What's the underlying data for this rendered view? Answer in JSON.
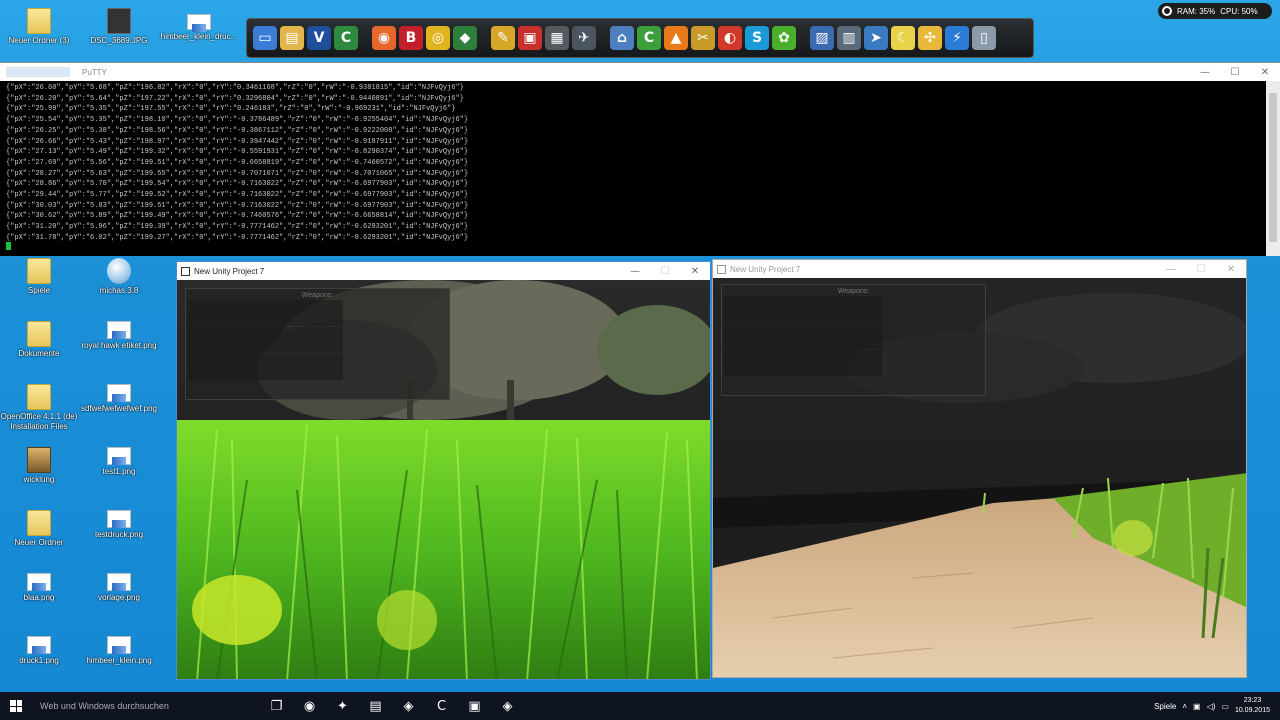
{
  "desktop_icons_top": [
    {
      "label": "Neuer Ordner (3)",
      "icon": "folder-icon"
    },
    {
      "label": "DSC_3689.JPG",
      "icon": "image-file-icon"
    },
    {
      "label": "himbeer_klein_druc...",
      "icon": "png-file-icon"
    }
  ],
  "desktop_icons": [
    {
      "label": "Spiele",
      "icon": "folder-icon"
    },
    {
      "label": "michas.3.8",
      "icon": "globe-icon"
    },
    {
      "label": "Dokumente",
      "icon": "folder-icon"
    },
    {
      "label": "royal hawk etiket.png",
      "icon": "png-file-icon"
    },
    {
      "label": "OpenOffice 4.1.1 (de) Installation Files",
      "icon": "folder-icon"
    },
    {
      "label": "sdfwefwefwefwef.png",
      "icon": "png-file-icon"
    },
    {
      "label": "wicklung",
      "icon": "archive-icon"
    },
    {
      "label": "test1.png",
      "icon": "png-file-icon"
    },
    {
      "label": "Neuer Ordner",
      "icon": "folder-icon"
    },
    {
      "label": "testdruck.png",
      "icon": "png-file-icon"
    },
    {
      "label": "blaa.png",
      "icon": "png-file-icon"
    },
    {
      "label": "vorlage.png",
      "icon": "png-file-icon"
    },
    {
      "label": "druck1.png",
      "icon": "png-file-icon"
    },
    {
      "label": "himbeer_klein.png",
      "icon": "png-file-icon"
    }
  ],
  "launcher": {
    "items": [
      {
        "name": "monitor-icon",
        "glyph": "▭",
        "color": "#3b7cd4"
      },
      {
        "name": "folder-icon",
        "glyph": "▤",
        "color": "#e2b64a"
      },
      {
        "name": "visual-assist-icon",
        "glyph": "V",
        "color": "#1e4f9c"
      },
      {
        "name": "csharp-icon",
        "glyph": "C",
        "color": "#2d8a3e"
      },
      {
        "name": "firefox-icon",
        "glyph": "◉",
        "color": "#e8662a"
      },
      {
        "name": "b-app-icon",
        "glyph": "B",
        "color": "#c21f2a"
      },
      {
        "name": "chrome-icon",
        "glyph": "◎",
        "color": "#e0b320"
      },
      {
        "name": "mutant-icon",
        "glyph": "◆",
        "color": "#2d7f3a"
      },
      {
        "name": "pen-tool-icon",
        "glyph": "✎",
        "color": "#d7a72a"
      },
      {
        "name": "media-icon",
        "glyph": "▣",
        "color": "#c9302c"
      },
      {
        "name": "tv-icon",
        "glyph": "▦",
        "color": "#555a60"
      },
      {
        "name": "fighter-icon",
        "glyph": "✈",
        "color": "#4a5560"
      },
      {
        "name": "network-icon",
        "glyph": "⌂",
        "color": "#4c7fc0"
      },
      {
        "name": "cura-icon",
        "glyph": "C",
        "color": "#3c9f3c"
      },
      {
        "name": "vlc-icon",
        "glyph": "▲",
        "color": "#e87a1a"
      },
      {
        "name": "tools-icon",
        "glyph": "✂",
        "color": "#c89a2a"
      },
      {
        "name": "alarm-icon",
        "glyph": "◐",
        "color": "#d13a2a"
      },
      {
        "name": "skype-icon",
        "glyph": "S",
        "color": "#1a9bd8"
      },
      {
        "name": "icq-icon",
        "glyph": "✿",
        "color": "#4caf2a"
      },
      {
        "name": "network-drive-icon",
        "glyph": "▨",
        "color": "#3a6ab0"
      },
      {
        "name": "usb-icon",
        "glyph": "▥",
        "color": "#5a6a7a"
      },
      {
        "name": "arrow-icon",
        "glyph": "➤",
        "color": "#3a7ac0"
      },
      {
        "name": "moon-icon",
        "glyph": "☾",
        "color": "#e8d24a"
      },
      {
        "name": "hub-icon",
        "glyph": "✣",
        "color": "#e8b83a"
      },
      {
        "name": "bolt-icon",
        "glyph": "⚡",
        "color": "#2a7ad8"
      },
      {
        "name": "recycle-bin-icon",
        "glyph": "▯",
        "color": "#8a9aa8"
      }
    ]
  },
  "meter": {
    "ram": "RAM: 35%",
    "cpu": "CPU: 50%"
  },
  "putty": {
    "title": "PuTTY",
    "lines": [
      "{\"pX\":\"26.60\",\"pY\":\"5.68\",\"pZ\":\"196.82\",\"rX\":\"0\",\"rY\":\"0.3461168\",\"rZ\":\"0\",\"rW\":\"-0.9381815\",\"id\":\"NJFvQyj6\"}",
      "{\"pX\":\"26.20\",\"pY\":\"5.64\",\"pZ\":\"197.22\",\"rX\":\"0\",\"rY\":\"0.3296804\",\"rZ\":\"0\",\"rW\":\"-0.9440891\",\"id\":\"NJFvQyj6\"}",
      "{\"pX\":\"25.99\",\"pY\":\"5.35\",\"pZ\":\"197.55\",\"rX\":\"0\",\"rY\":\"0.246183\",\"rZ\":\"0\",\"rW\":\"-0.969231\",\"id\":\"NJFvQyj6\"}",
      "{\"pX\":\"25.54\",\"pY\":\"5.35\",\"pZ\":\"198.10\",\"rX\":\"0\",\"rY\":\"-0.3786489\",\"rZ\":\"0\",\"rW\":\"-0.9255404\",\"id\":\"NJFvQyj6\"}",
      "{\"pX\":\"26.25\",\"pY\":\"5.38\",\"pZ\":\"198.56\",\"rX\":\"0\",\"rY\":\"-0.3867112\",\"rZ\":\"0\",\"rW\":\"-0.9222008\",\"id\":\"NJFvQyj6\"}",
      "{\"pX\":\"26.66\",\"pY\":\"5.43\",\"pZ\":\"198.97\",\"rX\":\"0\",\"rY\":\"-0.3947442\",\"rZ\":\"0\",\"rW\":\"-0.9187911\",\"id\":\"NJFvQyj6\"}",
      "{\"pX\":\"27.13\",\"pY\":\"5.49\",\"pZ\":\"199.32\",\"rX\":\"0\",\"rY\":\"-0.5591931\",\"rZ\":\"0\",\"rW\":\"-0.8290374\",\"id\":\"NJFvQyj6\"}",
      "{\"pX\":\"27.69\",\"pY\":\"5.56\",\"pZ\":\"199.51\",\"rX\":\"0\",\"rY\":\"-0.6658819\",\"rZ\":\"0\",\"rW\":\"-0.7460572\",\"id\":\"NJFvQyj6\"}",
      "{\"pX\":\"28.27\",\"pY\":\"5.63\",\"pZ\":\"199.55\",\"rX\":\"0\",\"rY\":\"-0.7071071\",\"rZ\":\"0\",\"rW\":\"-0.7071065\",\"id\":\"NJFvQyj6\"}",
      "{\"pX\":\"28.86\",\"pY\":\"5.70\",\"pZ\":\"199.54\",\"rX\":\"0\",\"rY\":\"-0.7163022\",\"rZ\":\"0\",\"rW\":\"-0.6977903\",\"id\":\"NJFvQyj6\"}",
      "{\"pX\":\"29.44\",\"pY\":\"5.77\",\"pZ\":\"199.52\",\"rX\":\"0\",\"rY\":\"-0.7163022\",\"rZ\":\"0\",\"rW\":\"-0.6977903\",\"id\":\"NJFvQyj6\"}",
      "{\"pX\":\"30.03\",\"pY\":\"5.83\",\"pZ\":\"199.51\",\"rX\":\"0\",\"rY\":\"-0.7163022\",\"rZ\":\"0\",\"rW\":\"-0.6977903\",\"id\":\"NJFvQyj6\"}",
      "{\"pX\":\"30.62\",\"pY\":\"5.89\",\"pZ\":\"199.49\",\"rX\":\"0\",\"rY\":\"-0.7460576\",\"rZ\":\"0\",\"rW\":\"-0.6658814\",\"id\":\"NJFvQyj6\"}",
      "{\"pX\":\"31.20\",\"pY\":\"5.96\",\"pZ\":\"199.39\",\"rX\":\"0\",\"rY\":\"-0.7771462\",\"rZ\":\"0\",\"rW\":\"-0.6293201\",\"id\":\"NJFvQyj6\"}",
      "{\"pX\":\"31.78\",\"pY\":\"6.02\",\"pZ\":\"199.27\",\"rX\":\"0\",\"rY\":\"-0.7771462\",\"rZ\":\"0\",\"rW\":\"-0.6293201\",\"id\":\"NJFvQyj6\"}"
    ],
    "minimize": "—",
    "maximize": "☐",
    "close": "✕"
  },
  "unity_left": {
    "title": "New Unity Project 7",
    "panel_title": "Weapons:",
    "minimize": "—",
    "maximize": "☐",
    "close": "✕"
  },
  "unity_right": {
    "title": "New Unity Project 7",
    "panel_title": "Weapons:",
    "minimize": "—",
    "maximize": "☐",
    "close": "✕"
  },
  "taskbar": {
    "search_placeholder": "Web und Windows durchsuchen",
    "buttons": [
      {
        "name": "task-view-icon",
        "glyph": "❐"
      },
      {
        "name": "firefox-taskbar-icon",
        "glyph": "◉"
      },
      {
        "name": "cura-taskbar-icon",
        "glyph": "✦"
      },
      {
        "name": "explorer-taskbar-icon",
        "glyph": "▤"
      },
      {
        "name": "unity-taskbar-icon",
        "glyph": "◈"
      },
      {
        "name": "putty-taskbar-icon",
        "glyph": "C"
      },
      {
        "name": "terminal-taskbar-icon",
        "glyph": "▣"
      },
      {
        "name": "unity2-taskbar-icon",
        "glyph": "◈"
      }
    ],
    "tray_label": "Spiele",
    "time": "23:23",
    "date": "10.09.2015"
  }
}
